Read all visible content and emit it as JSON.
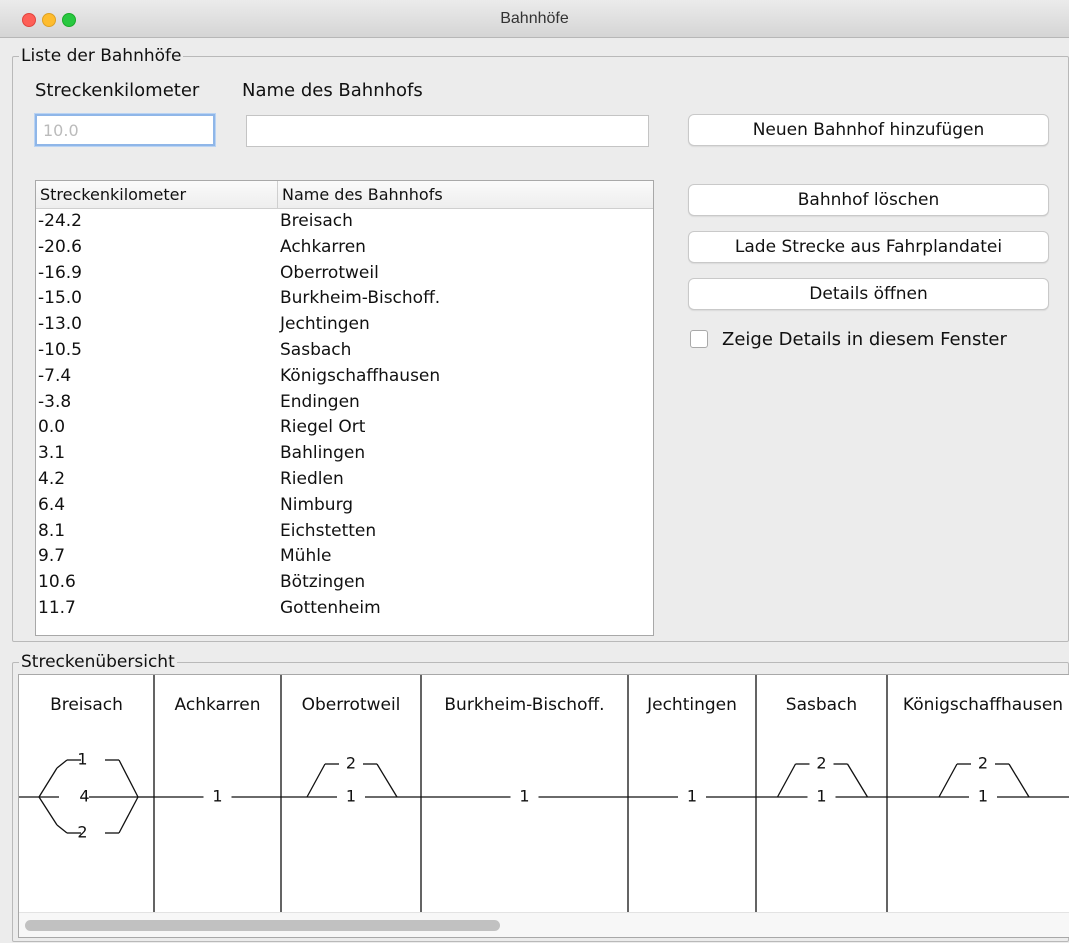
{
  "window": {
    "title": "Bahnhöfe"
  },
  "list_section": {
    "legend": "Liste der Bahnhöfe",
    "km_label": "Streckenkilometer",
    "name_label": "Name des Bahnhofs",
    "km_input": {
      "value": "",
      "placeholder": "10.0"
    },
    "name_input": {
      "value": "",
      "placeholder": ""
    },
    "buttons": {
      "add": "Neuen Bahnhof hinzufügen",
      "delete": "Bahnhof löschen",
      "load": "Lade Strecke aus Fahrplandatei",
      "details": "Details öffnen"
    },
    "checkbox": {
      "label": "Zeige Details in diesem Fenster",
      "checked": false
    },
    "table": {
      "columns": [
        "Streckenkilometer",
        "Name des Bahnhofs"
      ],
      "rows": [
        [
          "-24.2",
          "Breisach"
        ],
        [
          "-20.6",
          "Achkarren"
        ],
        [
          "-16.9",
          "Oberrotweil"
        ],
        [
          "-15.0",
          "Burkheim-Bischoff."
        ],
        [
          "-13.0",
          "Jechtingen"
        ],
        [
          "-10.5",
          "Sasbach"
        ],
        [
          "-7.4",
          "Königschaffhausen"
        ],
        [
          "-3.8",
          "Endingen"
        ],
        [
          "0.0",
          "Riegel Ort"
        ],
        [
          "3.1",
          "Bahlingen"
        ],
        [
          "4.2",
          "Riedlen"
        ],
        [
          "6.4",
          "Nimburg"
        ],
        [
          "8.1",
          "Eichstetten"
        ],
        [
          "9.7",
          "Mühle"
        ],
        [
          "10.6",
          "Bötzingen"
        ],
        [
          "11.7",
          "Gottenheim"
        ]
      ]
    }
  },
  "overview_section": {
    "legend": "Streckenübersicht",
    "stations": [
      {
        "name": "Breisach",
        "tracks": [
          "1",
          "4",
          "2"
        ]
      },
      {
        "name": "Achkarren",
        "tracks": [
          "1"
        ]
      },
      {
        "name": "Oberrotweil",
        "tracks": [
          "2",
          "1"
        ]
      },
      {
        "name": "Burkheim-Bischoff.",
        "tracks": [
          "1"
        ]
      },
      {
        "name": "Jechtingen",
        "tracks": [
          "1"
        ]
      },
      {
        "name": "Sasbach",
        "tracks": [
          "2",
          "1"
        ]
      },
      {
        "name": "Königschaffhausen",
        "tracks": [
          "2",
          "1"
        ]
      }
    ],
    "horizontal_scroll_fraction": 0.45
  }
}
